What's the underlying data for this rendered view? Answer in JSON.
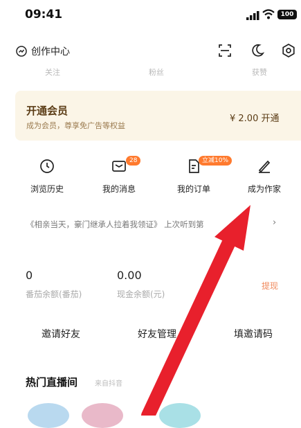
{
  "status_bar": {
    "time": "09:41",
    "battery": "100"
  },
  "topbar": {
    "creation_label": "创作中心"
  },
  "stats": [
    "关注",
    "粉丝",
    "获赞"
  ],
  "vip": {
    "title": "开通会员",
    "subtitle": "成为会员，尊享免广告等权益",
    "price_cta": "¥ 2.00 开通"
  },
  "quick_actions": [
    {
      "label": "浏览历史",
      "icon": "clock-icon"
    },
    {
      "label": "我的消息",
      "icon": "message-icon",
      "badge": "28"
    },
    {
      "label": "我的订单",
      "icon": "order-icon",
      "badge": "立减10%"
    },
    {
      "label": "成为作家",
      "icon": "pen-icon"
    }
  ],
  "history": {
    "text": "《相亲当天，豪门继承人拉着我领证》 上次听到第",
    "arrow": "›"
  },
  "wallet": {
    "coins_value": "0",
    "coins_label": "番茄余额(番茄)",
    "cash_value": "0.00",
    "cash_label": "现金余额(元)",
    "withdraw_label": "提现"
  },
  "invite_actions": [
    "邀请好友",
    "好友管理",
    "填邀请码"
  ],
  "live": {
    "title": "热门直播间",
    "source": "来自抖音"
  },
  "colors": {
    "accent": "#ff7a2e",
    "vip_bg": "#fbf5e7",
    "arrow": "#e8202c"
  }
}
